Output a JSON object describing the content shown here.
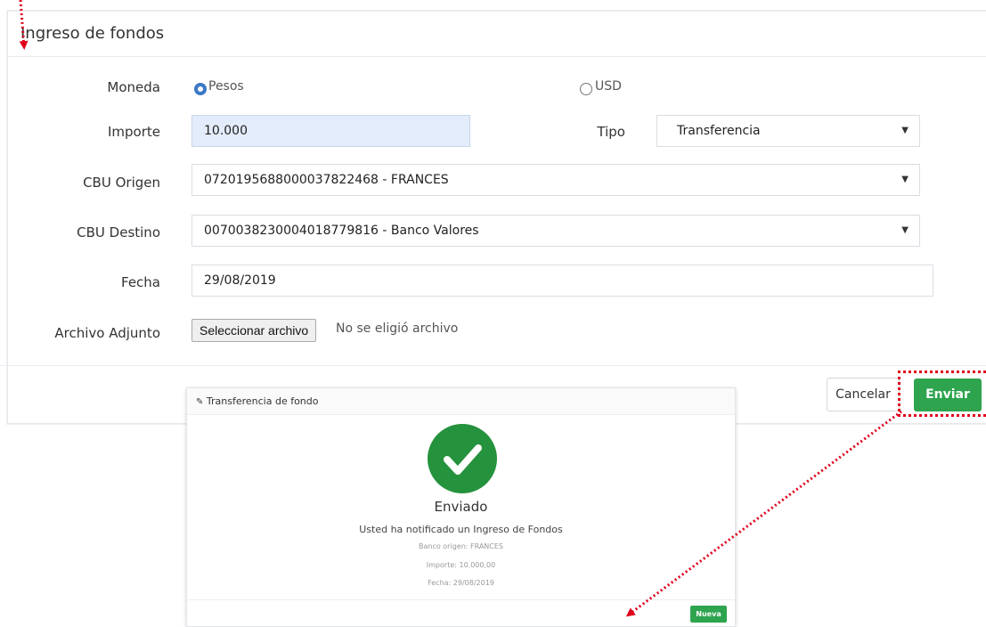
{
  "panel": {
    "title": "Ingreso de fondos"
  },
  "form": {
    "moneda": {
      "label": "Moneda",
      "options": [
        "Pesos",
        "USD"
      ],
      "selected": "Pesos"
    },
    "importe": {
      "label": "Importe",
      "value": "10.000"
    },
    "tipo": {
      "label": "Tipo",
      "value": "Transferencia"
    },
    "cbu_origen": {
      "label": "CBU Origen",
      "value": "0720195688000037822468 - FRANCES"
    },
    "cbu_destino": {
      "label": "CBU Destino",
      "value": "0070038230004018779816 - Banco Valores"
    },
    "fecha": {
      "label": "Fecha",
      "value": "29/08/2019"
    },
    "archivo": {
      "label": "Archivo Adjunto",
      "button": "Seleccionar archivo",
      "status": "No se eligió archivo"
    }
  },
  "actions": {
    "cancel": "Cancelar",
    "send": "Enviar"
  },
  "modal": {
    "title": "Transferencia de fondo",
    "status": "Enviado",
    "message": "Usted ha notificado un Ingreso de Fondos",
    "banco": "Banco origen: FRANCES",
    "importe": "Importe: 10.000,00",
    "fecha": "Fecha: 29/08/2019",
    "new_button": "Nueva"
  },
  "colors": {
    "accent_green": "#2ea44f",
    "annotation_red": "#e0001b",
    "radio_blue": "#3b78c6"
  },
  "icons": {
    "pencil": "pencil-icon",
    "check": "check-circle-icon",
    "caret": "caret-down-icon"
  }
}
